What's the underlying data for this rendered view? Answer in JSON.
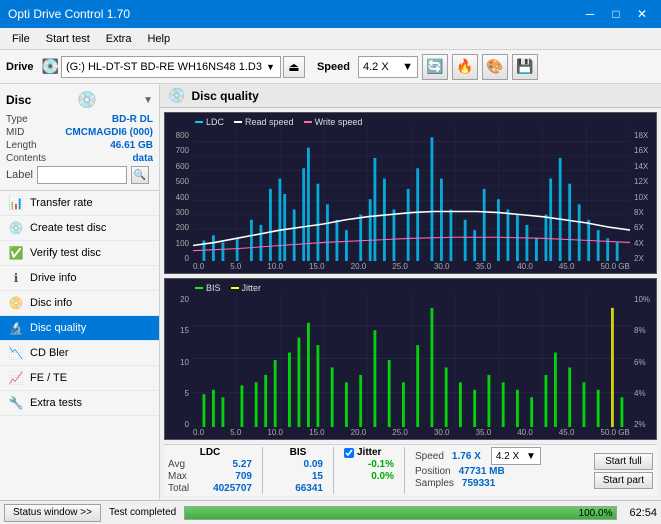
{
  "titlebar": {
    "title": "Opti Drive Control 1.70",
    "min_btn": "─",
    "max_btn": "□",
    "close_btn": "✕"
  },
  "menubar": {
    "items": [
      "File",
      "Start test",
      "Extra",
      "Help"
    ]
  },
  "toolbar": {
    "drive_label": "Drive",
    "drive_value": "(G:) HL-DT-ST BD-RE  WH16NS48 1.D3",
    "speed_label": "Speed",
    "speed_value": "4.2 X"
  },
  "disc_panel": {
    "title": "Disc",
    "rows": [
      {
        "label": "Type",
        "value": "BD-R DL"
      },
      {
        "label": "MID",
        "value": "CMCMAGDI6 (000)"
      },
      {
        "label": "Length",
        "value": "46.61 GB"
      },
      {
        "label": "Contents",
        "value": "data"
      }
    ],
    "label_placeholder": ""
  },
  "nav": {
    "items": [
      {
        "id": "transfer-rate",
        "label": "Transfer rate",
        "icon": "📊"
      },
      {
        "id": "create-test-disc",
        "label": "Create test disc",
        "icon": "💿"
      },
      {
        "id": "verify-test-disc",
        "label": "Verify test disc",
        "icon": "✅"
      },
      {
        "id": "drive-info",
        "label": "Drive info",
        "icon": "ℹ"
      },
      {
        "id": "disc-info",
        "label": "Disc info",
        "icon": "📀"
      },
      {
        "id": "disc-quality",
        "label": "Disc quality",
        "icon": "🔬",
        "active": true
      },
      {
        "id": "cd-bler",
        "label": "CD Bler",
        "icon": "📉"
      },
      {
        "id": "fe-te",
        "label": "FE / TE",
        "icon": "📈"
      },
      {
        "id": "extra-tests",
        "label": "Extra tests",
        "icon": "🔧"
      }
    ]
  },
  "disc_quality": {
    "title": "Disc quality",
    "chart1": {
      "legend": [
        "LDC",
        "Read speed",
        "Write speed"
      ],
      "y_labels_left": [
        "800",
        "700",
        "600",
        "500",
        "400",
        "300",
        "200",
        "100",
        "0"
      ],
      "y_labels_right": [
        "18X",
        "16X",
        "14X",
        "12X",
        "10X",
        "8X",
        "6X",
        "4X",
        "2X"
      ],
      "x_labels": [
        "0.0",
        "5.0",
        "10.0",
        "15.0",
        "20.0",
        "25.0",
        "30.0",
        "35.0",
        "40.0",
        "45.0",
        "50.0 GB"
      ]
    },
    "chart2": {
      "legend": [
        "BIS",
        "Jitter"
      ],
      "y_labels_left": [
        "20",
        "15",
        "10",
        "5",
        "0"
      ],
      "y_labels_right": [
        "10%",
        "8%",
        "6%",
        "4%",
        "2%"
      ],
      "x_labels": [
        "0.0",
        "5.0",
        "10.0",
        "15.0",
        "20.0",
        "25.0",
        "30.0",
        "35.0",
        "40.0",
        "45.0",
        "50.0 GB"
      ]
    }
  },
  "stats": {
    "columns": [
      "LDC",
      "BIS"
    ],
    "jitter_label": "Jitter",
    "jitter_checked": true,
    "rows": [
      {
        "label": "Avg",
        "ldc": "5.27",
        "bis": "0.09",
        "jitter": "-0.1%"
      },
      {
        "label": "Max",
        "ldc": "709",
        "bis": "15",
        "jitter": "0.0%"
      },
      {
        "label": "Total",
        "ldc": "4025707",
        "bis": "66341",
        "jitter": ""
      }
    ],
    "speed_label": "Speed",
    "speed_value": "1.76 X",
    "speed_select": "4.2 X",
    "position_label": "Position",
    "position_value": "47731 MB",
    "samples_label": "Samples",
    "samples_value": "759331",
    "start_full_btn": "Start full",
    "start_part_btn": "Start part"
  },
  "statusbar": {
    "status_window_btn": "Status window >>",
    "status_text": "Test completed",
    "progress": 100,
    "progress_text": "100.0%",
    "time": "62:54"
  },
  "colors": {
    "accent": "#0078d7",
    "ldc_color": "#00ccff",
    "read_speed_color": "#ffffff",
    "write_speed_color": "#ff69b4",
    "bis_color": "#00ff00",
    "jitter_color": "#ffff00",
    "grid_color": "#2a2a4a",
    "chart_bg": "#1a1a35"
  }
}
